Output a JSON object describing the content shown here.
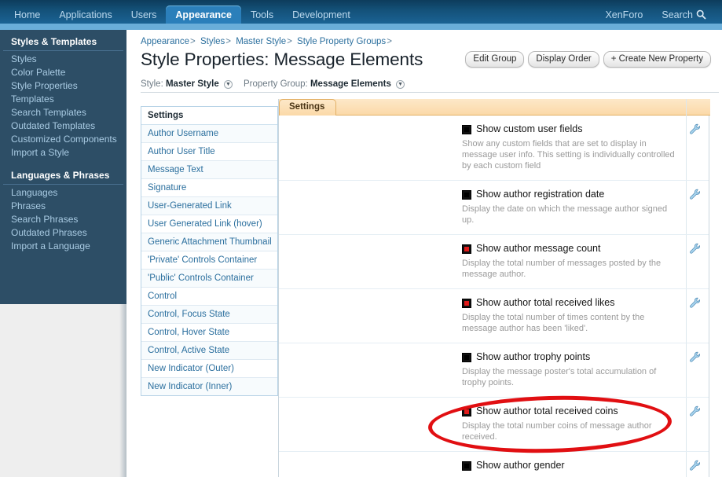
{
  "topnav": {
    "items": [
      {
        "label": "Home",
        "active": false
      },
      {
        "label": "Applications",
        "active": false
      },
      {
        "label": "Users",
        "active": false
      },
      {
        "label": "Appearance",
        "active": true
      },
      {
        "label": "Tools",
        "active": false
      },
      {
        "label": "Development",
        "active": false
      }
    ],
    "brand": "XenForo",
    "search_label": "Search",
    "search_icon": "search-icon"
  },
  "sidebar": {
    "groups": [
      {
        "heading": "Styles & Templates",
        "items": [
          "Styles",
          "Color Palette",
          "Style Properties",
          "Templates",
          "Search Templates",
          "Outdated Templates",
          "Customized Components",
          "Import a Style"
        ]
      },
      {
        "heading": "Languages & Phrases",
        "items": [
          "Languages",
          "Phrases",
          "Search Phrases",
          "Outdated Phrases",
          "Import a Language"
        ]
      }
    ]
  },
  "breadcrumb": [
    {
      "label": "Appearance",
      "sep": ">"
    },
    {
      "label": "Styles",
      "sep": ">"
    },
    {
      "label": "Master Style",
      "sep": ">"
    },
    {
      "label": "Style Property Groups",
      "sep": ">"
    }
  ],
  "page": {
    "title": "Style Properties: Message Elements",
    "buttons": [
      "Edit Group",
      "Display Order",
      "+ Create New Property"
    ],
    "style_label": "Style:",
    "style_value": "Master Style",
    "group_label": "Property Group:",
    "group_value": "Message Elements"
  },
  "settings_list": {
    "header": "Settings",
    "items": [
      "Author Username",
      "Author User Title",
      "Message Text",
      "Signature",
      "User-Generated Link",
      "User Generated Link (hover)",
      "Generic Attachment Thumbnail",
      "'Private' Controls Container",
      "'Public' Controls Container",
      "Control",
      "Control, Focus State",
      "Control, Hover State",
      "Control, Active State",
      "New Indicator (Outer)",
      "New Indicator (Inner)"
    ]
  },
  "panel": {
    "tab_label": "Settings",
    "rows": [
      {
        "title": "Show custom user fields",
        "desc": "Show any custom fields that are set to display in message user info. This setting is individually controlled by each custom field",
        "modified": false,
        "icon": "wrench-icon"
      },
      {
        "title": "Show author registration date",
        "desc": "Display the date on which the message author signed up.",
        "modified": false,
        "icon": "wrench-icon"
      },
      {
        "title": "Show author message count",
        "desc": "Display the total number of messages posted by the message author.",
        "modified": true,
        "icon": "wrench-icon"
      },
      {
        "title": "Show author total received likes",
        "desc": "Display the total number of times content by the message author has been 'liked'.",
        "modified": true,
        "icon": "wrench-icon"
      },
      {
        "title": "Show author trophy points",
        "desc": "Display the message poster's total accumulation of trophy points.",
        "modified": false,
        "icon": "wrench-icon"
      },
      {
        "title": "Show author total received coins",
        "desc": "Display the total number coins of message author received.",
        "modified": true,
        "icon": "wrench-icon"
      },
      {
        "title": "Show author gender",
        "desc": "",
        "modified": false,
        "icon": "wrench-icon"
      }
    ]
  },
  "annotation": {
    "shape": "ellipse",
    "color": "#e10f12",
    "targets": "Show author total received coins"
  },
  "colors": {
    "nav_dark": "#0d3c5c",
    "nav_active": "#2b7fba",
    "nav_strip": "#6aaed9",
    "sidebar_bg": "#2d4e66",
    "link_blue": "#2b6f9e",
    "tab_orange": "#fbd9a8",
    "annotation_red": "#e10f12",
    "modified_red": "#e01b1b"
  }
}
